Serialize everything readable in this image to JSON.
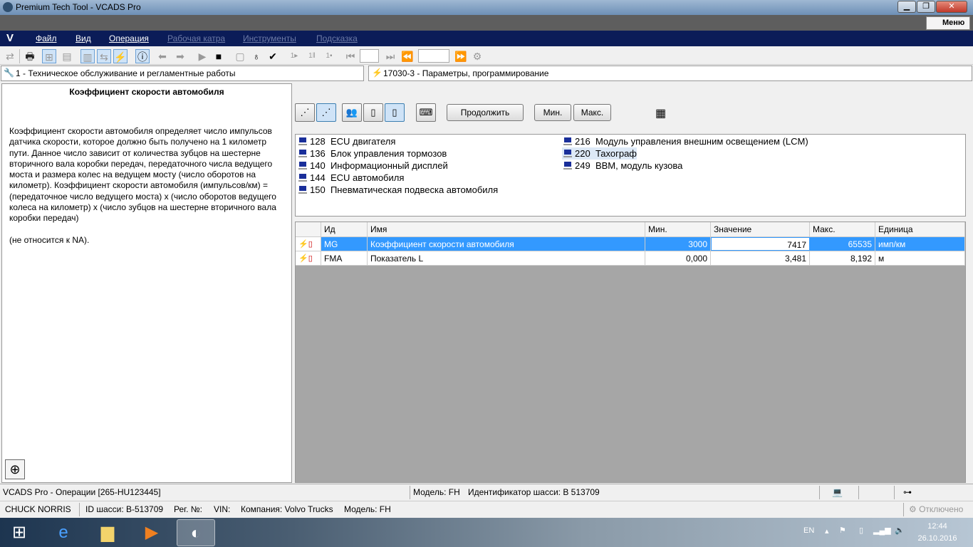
{
  "window": {
    "title": "Premium Tech Tool - VCADS Pro",
    "menu_button": "Меню"
  },
  "menubar": {
    "logo": "V",
    "items": [
      "Файл",
      "Вид",
      "Операция",
      "Рабочая катра",
      "Инструменты",
      "Подсказка"
    ]
  },
  "path": {
    "left": "1 - Техническое обслуживание и регламентные работы",
    "right": "17030-3 - Параметры, программирование"
  },
  "left_panel": {
    "title": "Коэффициент скорости автомобиля",
    "description": "Коэффициент скорости автомобиля определяет число импульсов датчика скорости, которое должно быть получено на 1 километр пути. Данное число зависит от количества зубцов на шестерне вторичного вала коробки передач, передаточного числа ведущего моста и размера колес на ведущем мосту (число оборотов на километр). Коэффициент скорости автомобиля (импульсов/км) = (передаточное число ведущего моста) x (число оборотов ведущего колеса на километр) x (число зубцов на шестерне вторичного вала коробки передач)\n\n(не относится к NA)."
  },
  "buttons": {
    "continue": "Продолжить",
    "min": "Мин.",
    "max": "Макс."
  },
  "ecus": [
    {
      "num": "128",
      "name": "ECU двигателя"
    },
    {
      "num": "136",
      "name": "Блок управления тормозов"
    },
    {
      "num": "140",
      "name": "Информационный дисплей"
    },
    {
      "num": "144",
      "name": "ECU автомобиля"
    },
    {
      "num": "150",
      "name": "Пневматическая подвеска автомобиля"
    },
    {
      "num": "216",
      "name": "Модуль управления внешним освещением (LCM)"
    },
    {
      "num": "220",
      "name": "Тахограф"
    },
    {
      "num": "249",
      "name": "BBM, модуль кузова"
    }
  ],
  "table": {
    "headers": [
      "Ид",
      "Имя",
      "Мин.",
      "Значение",
      "Макс.",
      "Единица"
    ],
    "rows": [
      {
        "id": "MG",
        "name": "Коэффициент скорости автомобиля",
        "min": "3000",
        "value": "7417",
        "max": "65535",
        "unit": "имп/км"
      },
      {
        "id": "FMA",
        "name": "Показатель L",
        "min": "0,000",
        "value": "3,481",
        "max": "8,192",
        "unit": "м"
      }
    ]
  },
  "status": {
    "operations": "VCADS Pro - Операции   [265-HU123445]",
    "model": "Модель: FH",
    "chassis_id": "Идентификатор шасси: B   513709",
    "user": "CHUCK NORRIS",
    "chassis": "ID шасси: B-513709",
    "reg": "Рег. №:",
    "vin": "VIN:",
    "company": "Компания: Volvo Trucks",
    "model2": "Модель: FH",
    "connection": "Отключено"
  },
  "taskbar": {
    "lang": "EN",
    "time": "12:44",
    "date": "26.10.2016"
  }
}
